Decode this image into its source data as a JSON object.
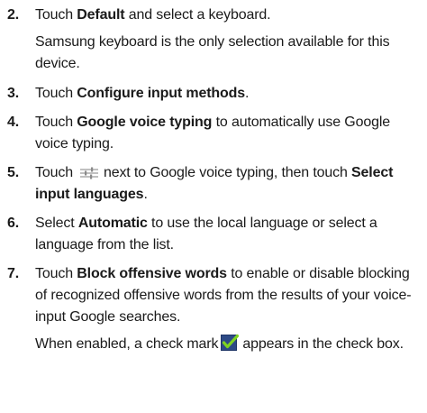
{
  "steps": [
    {
      "num": "2.",
      "pre": "Touch ",
      "bold": "Default",
      "post": " and select a keyboard.",
      "note": "Samsung keyboard is the only selection available for this device."
    },
    {
      "num": "3.",
      "pre": "Touch ",
      "bold": "Configure input methods",
      "post": "."
    },
    {
      "num": "4.",
      "pre": "Touch ",
      "bold": "Google voice typing",
      "post": " to automatically use Google voice typing."
    },
    {
      "num": "5.",
      "pre": "Touch",
      "icon": "settings-icon",
      "mid": "next to Google voice typing, then touch ",
      "bold": "Select input languages",
      "post": "."
    },
    {
      "num": "6.",
      "pre": "Select ",
      "bold": "Automatic",
      "post": " to use the local language or select a language from the list."
    },
    {
      "num": "7.",
      "pre": "Touch ",
      "bold": "Block offensive words",
      "post": " to enable or disable blocking of recognized offensive words from the results of your voice-input Google searches.",
      "note_pre": "When enabled, a check mark",
      "note_icon": "check-mark-icon",
      "note_post": "appears in the check box."
    }
  ],
  "colors": {
    "check_fill": "#2d4a86",
    "check_mark": "#7ed321",
    "icon_gray": "#9a9a9a"
  }
}
